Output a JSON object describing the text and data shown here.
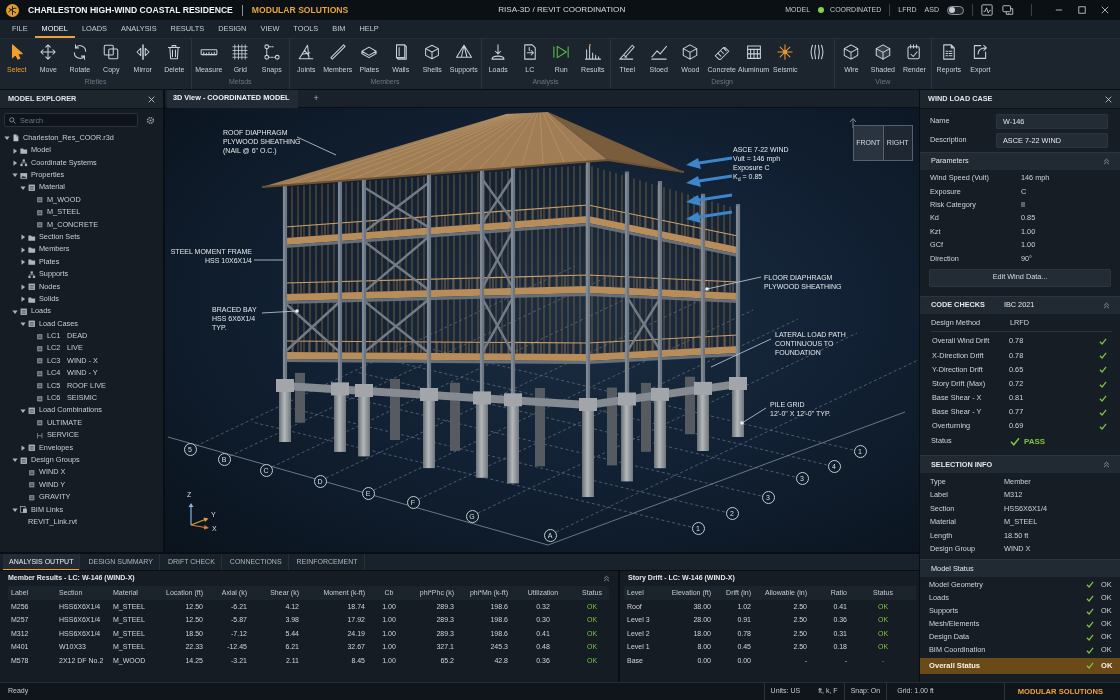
{
  "title_bar": {
    "project": "CHARLESTON HIGH-WIND COASTAL RESIDENCE",
    "company": "MODULAR SOLUTIONS",
    "app_title": "RISA-3D / REVIT COORDINATION",
    "model_label": "MODEL",
    "model_status": "COORDINATED",
    "methods": [
      "LFRD",
      "ASD"
    ],
    "asd_toggle": {
      "on": false
    }
  },
  "menu": [
    {
      "label": "FILE",
      "selected": false
    },
    {
      "label": "MODEL",
      "selected": true
    },
    {
      "label": "LOADS",
      "selected": false
    },
    {
      "label": "ANALYSIS",
      "selected": false
    },
    {
      "label": "RESULTS",
      "selected": false
    },
    {
      "label": "DESIGN",
      "selected": false
    },
    {
      "label": "VIEW",
      "selected": false
    },
    {
      "label": "TOOLS",
      "selected": false
    },
    {
      "label": "BIM",
      "selected": false
    },
    {
      "label": "HELP",
      "selected": false
    }
  ],
  "ribbon": [
    {
      "label": "Rtetles",
      "tools": [
        {
          "label": "Select",
          "kind": "select",
          "selected": true
        },
        {
          "label": "Move",
          "kind": "move",
          "selected": false
        },
        {
          "label": "Rotate",
          "kind": "rotate",
          "selected": false
        },
        {
          "label": "Copy",
          "kind": "copy",
          "selected": false
        },
        {
          "label": "Mirror",
          "kind": "mirror",
          "selected": false
        },
        {
          "label": "Delete",
          "kind": "delete",
          "selected": false
        }
      ]
    },
    {
      "label": "Metsds",
      "tools": [
        {
          "label": "Measure",
          "kind": "measure",
          "selected": false
        },
        {
          "label": "Grid",
          "kind": "grid",
          "selected": false
        },
        {
          "label": "Snaps",
          "kind": "snaps",
          "selected": false
        }
      ]
    },
    {
      "label": "Members",
      "tools": [
        {
          "label": "Joints",
          "kind": "joints",
          "selected": false
        },
        {
          "label": "Members",
          "kind": "members",
          "selected": false
        },
        {
          "label": "Plates",
          "kind": "plates",
          "selected": false
        },
        {
          "label": "Walls",
          "kind": "walls",
          "selected": false
        },
        {
          "label": "Shells",
          "kind": "shells",
          "selected": false
        },
        {
          "label": "Supports",
          "kind": "supports",
          "selected": false
        }
      ]
    },
    {
      "label": "Analysis",
      "tools": [
        {
          "label": "Loads",
          "kind": "loads",
          "selected": false
        },
        {
          "label": "LC",
          "kind": "lc",
          "selected": false
        },
        {
          "label": "Run",
          "kind": "run",
          "selected": false
        },
        {
          "label": "Results",
          "kind": "results",
          "selected": false
        }
      ]
    },
    {
      "label": "Design",
      "tools": [
        {
          "label": "Tteel",
          "kind": "steel",
          "selected": false
        },
        {
          "label": "Stoed",
          "kind": "stoed",
          "selected": false
        },
        {
          "label": "Wood",
          "kind": "wood",
          "selected": false
        },
        {
          "label": "Concrete",
          "kind": "concrete",
          "selected": false
        },
        {
          "label": "Aluminum",
          "kind": "aluminum",
          "selected": false
        },
        {
          "label": "Seismic",
          "kind": "seismic",
          "selected": false
        },
        {
          "kind": "sections",
          "selected": false
        }
      ]
    },
    {
      "label": "View",
      "tools": [
        {
          "label": "Wire",
          "kind": "wire",
          "selected": false
        },
        {
          "label": "Shaded",
          "kind": "shaded",
          "selected": false
        },
        {
          "label": "Render",
          "kind": "render",
          "selected": false
        }
      ]
    },
    {
      "tools": [
        {
          "label": "Reports",
          "kind": "reports",
          "selected": false
        },
        {
          "label": "Export",
          "kind": "export",
          "selected": false
        }
      ]
    }
  ],
  "model_explorer": {
    "title": "MODEL EXPLORER",
    "search": {
      "placeholder": "Search"
    },
    "tree": [
      {
        "label": "Charleston_Res_COOR.r3d",
        "kind": "file",
        "expanded": true,
        "children": [
          {
            "label": "Model",
            "kind": "folder",
            "expanded": false
          },
          {
            "label": "Coordinate Systems",
            "kind": "network",
            "expanded": false
          },
          {
            "label": "Properties",
            "kind": "gallery",
            "expanded": true,
            "children": [
              {
                "label": "Material",
                "kind": "table",
                "expanded": true,
                "children": [
                  {
                    "label": "M_WOOD",
                    "kind": "item"
                  },
                  {
                    "label": "M_STEEL",
                    "kind": "item"
                  },
                  {
                    "label": "M_CONCRETE",
                    "kind": "item"
                  }
                ]
              },
              {
                "label": "Section Sets",
                "kind": "folder",
                "expanded": false
              },
              {
                "label": "Members",
                "kind": "folder",
                "expanded": false
              },
              {
                "label": "Plates",
                "kind": "folder",
                "expanded": false
              },
              {
                "label": "Supports",
                "kind": "network"
              },
              {
                "label": "Nodes",
                "kind": "table",
                "expanded": false
              },
              {
                "label": "Solids",
                "kind": "folder",
                "expanded": false
              }
            ]
          },
          {
            "label": "Loads",
            "kind": "table",
            "expanded": true,
            "children": [
              {
                "label": "Load Cases",
                "kind": "table",
                "expanded": true,
                "children": [
                  {
                    "code": "LC1",
                    "label": "DEAD",
                    "kind": "item"
                  },
                  {
                    "code": "LC2",
                    "label": "LIVE",
                    "kind": "item"
                  },
                  {
                    "code": "LC3",
                    "label": "WIND - X",
                    "kind": "item"
                  },
                  {
                    "code": "LC4",
                    "label": "WIND - Y",
                    "kind": "item"
                  },
                  {
                    "code": "LC5",
                    "label": "ROOF LIVE",
                    "kind": "item"
                  },
                  {
                    "code": "LC6",
                    "label": "SEISMIC",
                    "kind": "item"
                  }
                ]
              },
              {
                "label": "Load Combinations",
                "kind": "table",
                "expanded": true,
                "children": [
                  {
                    "label": "ULTIMATE",
                    "kind": "item"
                  },
                  {
                    "label": "SERVICE",
                    "kind": "bracket"
                  }
                ]
              },
              {
                "label": "Envelopes",
                "kind": "table",
                "expanded": false
              }
            ]
          },
          {
            "label": "Design Groups",
            "kind": "table",
            "expanded": true,
            "children": [
              {
                "label": "WIND X",
                "kind": "item"
              },
              {
                "label": "WIND Y",
                "kind": "item"
              },
              {
                "label": "GRAVITY",
                "kind": "item"
              }
            ]
          },
          {
            "label": "BIM Links",
            "kind": "link",
            "expanded": true,
            "children": [
              {
                "label": "REVIT_Link.rvt",
                "kind": "plain"
              }
            ]
          }
        ]
      }
    ]
  },
  "viewport": {
    "tabs": [
      {
        "label": "3D View - COORDINATED MODEL",
        "selected": true
      }
    ],
    "add_tab": "+",
    "view_cube": [
      "FRONT",
      "RIGHT"
    ],
    "annotations": [
      {
        "lines": [
          "ROOF DIAPHRAGM",
          "PLYWOOD SHEATHING",
          "(NAIL @ 6\" O.C.)"
        ]
      },
      {
        "lines": [
          "ASCE 7-22 WIND",
          "Vult = 146 mph",
          "Exposure C",
          "K$_{d}$ = 0.85"
        ]
      },
      {
        "lines": [
          "STEEL MOMENT FRAME",
          "HSS 10X6X1/4"
        ]
      },
      {
        "lines": [
          "FLOOR DIAPHRAGM",
          "PLYWOOD SHEATHING"
        ]
      },
      {
        "lines": [
          "BRACED BAY",
          "HSS 6X6X1/4",
          "TYP."
        ]
      },
      {
        "lines": [
          "LATERAL LOAD PATH",
          "CONTINUOUS TO",
          "FOUNDATION"
        ]
      },
      {
        "lines": [
          "PILE GRID",
          "12'-0\" X 12'-0\" TYP."
        ]
      }
    ],
    "grid_bubbles": [
      "5",
      "B",
      "C",
      "D",
      "E",
      "F",
      "G",
      "A",
      "1",
      "4",
      "3",
      "3",
      "2",
      "1"
    ],
    "axes": [
      "Z",
      "Y",
      "X"
    ]
  },
  "wind_load_case": {
    "title": "WIND LOAD CASE",
    "fields": [
      {
        "label": "Name",
        "value": "W-146"
      },
      {
        "label": "Description",
        "value": "ASCE 7-22 WIND"
      }
    ]
  },
  "parameters": {
    "title": "Parameters",
    "expanded": true,
    "rows": [
      {
        "label": "Wind Speed (Vult)",
        "value": "146 mph"
      },
      {
        "label": "Exposure",
        "value": "C"
      },
      {
        "label": "Risk Category",
        "value": "II"
      },
      {
        "label": "Kd",
        "value": "0.85"
      },
      {
        "label": "Kzt",
        "value": "1.00"
      },
      {
        "label": "GCf",
        "value": "1.00"
      },
      {
        "label": "Direction",
        "value": "90°"
      }
    ],
    "button": "Edit Wind Data..."
  },
  "code_checks": {
    "title": "CODE CHECKS",
    "code": "IBC 2021",
    "expanded": true,
    "design_method": {
      "label": "Design Method",
      "value": "LRFD"
    },
    "checks": [
      {
        "label": "Overall Wind Drift",
        "value": "0.78",
        "passed": true
      },
      {
        "label": "X-Direction Drift",
        "value": "0.78",
        "passed": true
      },
      {
        "label": "Y-Direction Drift",
        "value": "0.65",
        "passed": true
      },
      {
        "label": "Story Drift (Max)",
        "value": "0.72",
        "passed": true
      },
      {
        "label": "Base Shear - X",
        "value": "0.81",
        "passed": true
      },
      {
        "label": "Base Shear - Y",
        "value": "0.77",
        "passed": true
      },
      {
        "label": "Overturning",
        "value": "0.69",
        "passed": true
      }
    ],
    "status": {
      "label": "Status",
      "value": "PASS",
      "passed": true
    }
  },
  "selection_info": {
    "title": "SELECTION INFO",
    "expanded": true,
    "rows": [
      {
        "label": "Type",
        "value": "Member"
      },
      {
        "label": "Label",
        "value": "M312"
      },
      {
        "label": "Section",
        "value": "HSS6X6X1/4"
      },
      {
        "label": "Material",
        "value": "M_STEEL"
      },
      {
        "label": "Length",
        "value": "18.50 ft"
      },
      {
        "label": "Design Group",
        "value": "WIND X"
      }
    ]
  },
  "model_status": {
    "title": "Model Status",
    "rows": [
      {
        "label": "Model Geometry",
        "value": "OK",
        "ok": true
      },
      {
        "label": "Loads",
        "value": "OK",
        "ok": true
      },
      {
        "label": "Supports",
        "value": "OK",
        "ok": true
      },
      {
        "label": "Mesh/Elements",
        "value": "OK",
        "ok": true
      },
      {
        "label": "Design Data",
        "value": "OK",
        "ok": true
      },
      {
        "label": "BIM Coordination",
        "value": "OK",
        "ok": true
      }
    ],
    "overall": {
      "label": "Overall Status",
      "value": "OK",
      "ok": true
    }
  },
  "output_panel": {
    "tabs": [
      {
        "label": "ANALYSIS OUTPUT",
        "selected": true
      },
      {
        "label": "DESIGN SUMMARY",
        "selected": false
      },
      {
        "label": "DRIFT CHECK",
        "selected": false
      },
      {
        "label": "CONNECTIONS",
        "selected": false
      },
      {
        "label": "REINFORCEMENT",
        "selected": false
      }
    ],
    "member_results": {
      "title": "Member Results - LC: W-146 (WIND-X)",
      "columns": [
        "Label",
        "Section",
        "Material",
        "Location (ft)",
        "Axial (k)",
        "Shear (k)",
        "Moment (k-ft)",
        "Cb",
        "phi*Phc (k)",
        "phi*Mn (k-ft)",
        "Utilization",
        "Status"
      ],
      "rows": [
        {
          "cells": [
            "M256",
            "HSS6X6X1/4",
            "M_STEEL",
            "12.50",
            "-6.21",
            "4.12",
            "18.74",
            "1.00",
            "289.3",
            "198.6",
            "0.32"
          ],
          "status": "OK",
          "passed": true
        },
        {
          "cells": [
            "M257",
            "HSS6X6X1/4",
            "M_STEEL",
            "12.50",
            "-5.87",
            "3.98",
            "17.92",
            "1.00",
            "289.3",
            "198.6",
            "0.30"
          ],
          "status": "OK",
          "passed": true
        },
        {
          "cells": [
            "M312",
            "HSS6X6X1/4",
            "M_STEEL",
            "18.50",
            "-7.12",
            "5.44",
            "24.19",
            "1.00",
            "289.3",
            "198.6",
            "0.41"
          ],
          "status": "OK",
          "passed": true
        },
        {
          "cells": [
            "M401",
            "W10X33",
            "M_STEEL",
            "22.33",
            "-12.45",
            "6.21",
            "32.67",
            "1.00",
            "327.1",
            "245.3",
            "0.48"
          ],
          "status": "OK",
          "passed": true
        },
        {
          "cells": [
            "M578",
            "2X12 DF No.2",
            "M_WOOD",
            "14.25",
            "-3.21",
            "2.11",
            "8.45",
            "1.00",
            "65.2",
            "42.8",
            "0.36"
          ],
          "status": "OK",
          "passed": true
        }
      ]
    },
    "story_drift": {
      "title": "Story Drift - LC: W-146 (WIND-X)",
      "columns": [
        "Level",
        "Elevation (ft)",
        "Drift (in)",
        "Allowable (in)",
        "Ratio",
        "Status"
      ],
      "rows": [
        {
          "cells": [
            "Roof",
            "38.00",
            "1.02",
            "2.50",
            "0.41"
          ],
          "status": "OK",
          "passed": true
        },
        {
          "cells": [
            "Level 3",
            "28.00",
            "0.91",
            "2.50",
            "0.36"
          ],
          "status": "OK",
          "passed": true
        },
        {
          "cells": [
            "Level 2",
            "18.00",
            "0.78",
            "2.50",
            "0.31"
          ],
          "status": "OK",
          "passed": true
        },
        {
          "cells": [
            "Level 1",
            "8.00",
            "0.45",
            "2.50",
            "0.18"
          ],
          "status": "OK",
          "passed": true
        },
        {
          "cells": [
            "Base",
            "0.00",
            "0.00",
            "-",
            "-"
          ],
          "status": "-"
        }
      ]
    }
  },
  "status_bar": {
    "message": "Ready",
    "units": "Units: US",
    "unit_set": "ft, k, F",
    "snap": "Snap: On",
    "grid": "Grid: 1.00 ft",
    "brand": "MODULAR SOLUTIONS"
  }
}
